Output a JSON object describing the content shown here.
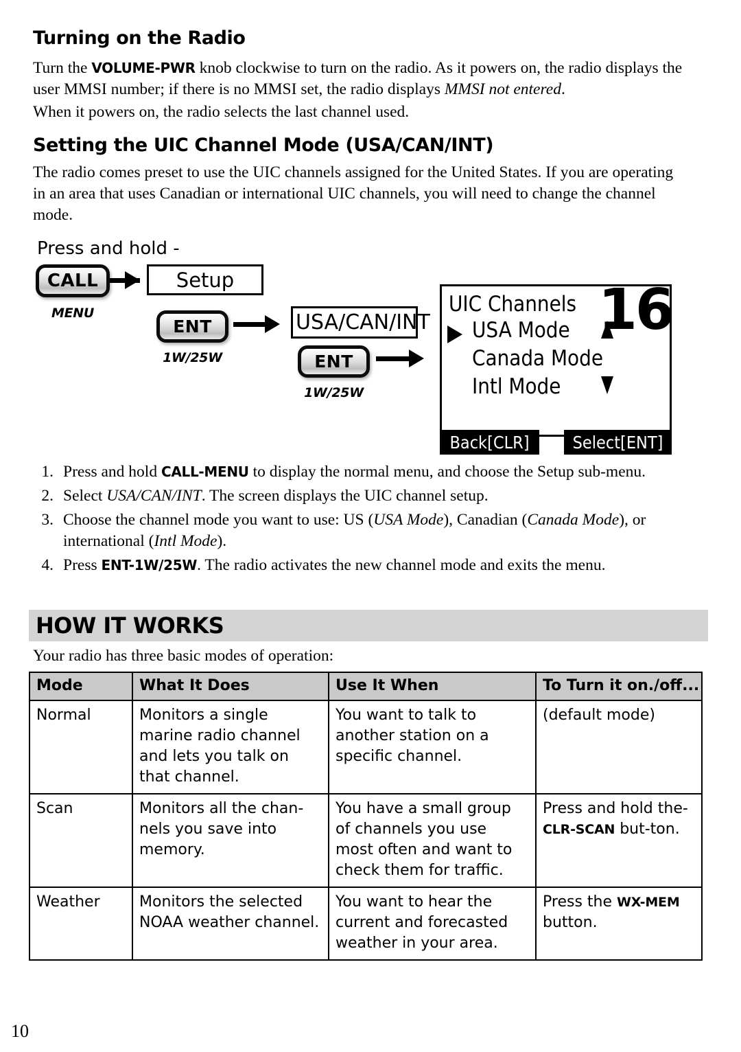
{
  "page": {
    "number": "10"
  },
  "section1": {
    "heading": "Turning on the Radio",
    "para1_a": "Turn the ",
    "para1_kbd": "VOLUME-PWR",
    "para1_b": " knob clockwise to turn on the radio. As it powers on, the radio displays the user MMSI number; if there is no MMSI set, the radio displays ",
    "para1_italic": "MMSI not entered",
    "para1_c": ".",
    "para2": "When it powers on, the radio selects the last channel used."
  },
  "section2": {
    "heading": "Setting the UIC Channel Mode (USA/CAN/INT)",
    "para1": "The radio comes preset to use the UIC channels assigned for the United States. If you are operating in an area that uses Canadian or international UIC channels, you will need to change the channel mode."
  },
  "diagram": {
    "press_and_hold_label": "Press and hold -",
    "call_button": "CALL",
    "call_button_sub": "MENU",
    "setup_box": "Setup",
    "ent_button_1": "ENT",
    "ent_button_1_sub": "1W/25W",
    "usacanint_box": "USA/CAN/INT",
    "ent_button_2": "ENT",
    "ent_button_2_sub": "1W/25W"
  },
  "lcd": {
    "title": "UIC Channels",
    "channel_number": "16",
    "items": [
      {
        "label": "USA Mode",
        "selected": true
      },
      {
        "label": "Canada Mode",
        "selected": false
      },
      {
        "label": "Intl Mode",
        "selected": false
      }
    ],
    "softkey_left": "Back[CLR]",
    "softkey_right": "Select[ENT]"
  },
  "steps": [
    {
      "num": "1.",
      "a": "Press and hold ",
      "kbd": "CALL-MENU",
      "b": " to display the normal menu, and choose the Setup sub-menu."
    },
    {
      "num": "2.",
      "a": "Select ",
      "italic": "USA/CAN/INT",
      "b": ". The screen displays the UIC channel setup."
    },
    {
      "num": "3.",
      "a": "Choose the channel mode you want to use: US (",
      "italic": "USA Mode",
      "b": "), Canadian (",
      "italic2": "Canada Mode",
      "c": "), or international (",
      "italic3": "Intl Mode",
      "d": ")."
    },
    {
      "num": "4.",
      "a": "Press ",
      "kbd": "ENT-1W/25W",
      "b": ". The radio activates the new channel mode and exits the menu."
    }
  ],
  "how_it_works": {
    "band_title": "HOW IT WORKS",
    "intro": "Your radio has three basic modes of operation:",
    "table": {
      "headers": [
        "Mode",
        "What It Does",
        "Use It When",
        "To Turn it on./off..."
      ],
      "rows": [
        {
          "mode": "Normal",
          "what": "Monitors a single marine radio channel and lets you talk on that channel.",
          "when": "You want to talk to another station on a specific channel.",
          "how_a": "(default mode)",
          "how_kbd": "",
          "how_b": ""
        },
        {
          "mode": "Scan",
          "what": "Monitors all the chan-nels you save into memory.",
          "when": "You have a small group of channels you use most often and want to check them for traffic.",
          "how_a": "Press and hold the-",
          "how_kbd": "CLR-SCAN",
          "how_b": " but-ton."
        },
        {
          "mode": "Weather",
          "what": "Monitors the selected NOAA weather channel.",
          "when": "You want to hear the current and forecasted weather in your area.",
          "how_a": "Press the ",
          "how_kbd": "WX-MEM",
          "how_b": " button."
        }
      ]
    }
  },
  "colors": {
    "band_gray": "#d4d4d4",
    "table_header_gray": "#c9c9c9",
    "ink": "#000000"
  }
}
